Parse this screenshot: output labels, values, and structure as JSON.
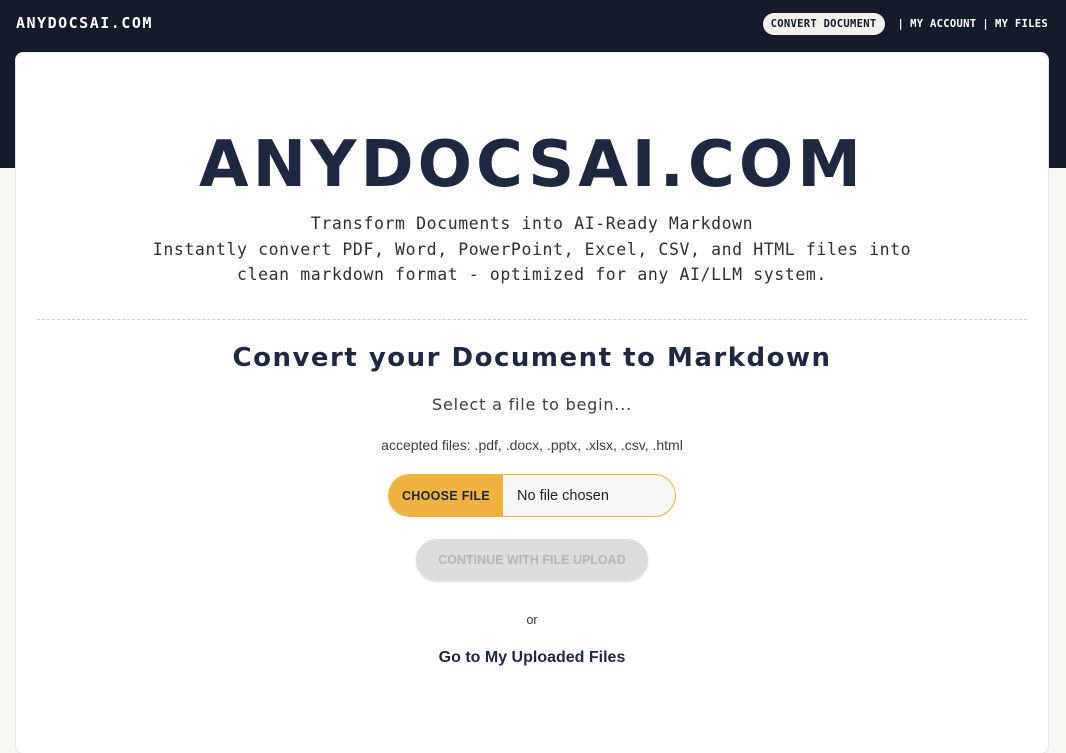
{
  "header": {
    "brand": "ANYDOCSAI.COM",
    "nav": {
      "convert_document": "CONVERT DOCUMENT",
      "separator": "|",
      "my_account": "MY ACCOUNT",
      "my_files": "MY FILES"
    }
  },
  "hero": {
    "title": "ANYDOCSAI.COM",
    "tagline_line1": "Transform Documents into AI-Ready Markdown",
    "tagline_line2": "Instantly convert PDF, Word, PowerPoint, Excel, CSV, and HTML files into",
    "tagline_line3": "clean markdown format - optimized for any AI/LLM system."
  },
  "converter": {
    "title": "Convert your Document to Markdown",
    "select_hint": "Select a file to begin...",
    "accepted_files": "accepted files: .pdf, .docx, .pptx, .xlsx, .csv, .html",
    "choose_file_label": "CHOOSE FILE",
    "file_status": "No file chosen",
    "continue_label": "CONTINUE WITH FILE UPLOAD",
    "or_text": "or",
    "my_files_link": "Go to My Uploaded Files"
  },
  "colors": {
    "header_bg": "#141b2d",
    "accent": "#f1b33f",
    "title_text": "#1e2840",
    "disabled_button_bg": "#dcdcdd"
  }
}
